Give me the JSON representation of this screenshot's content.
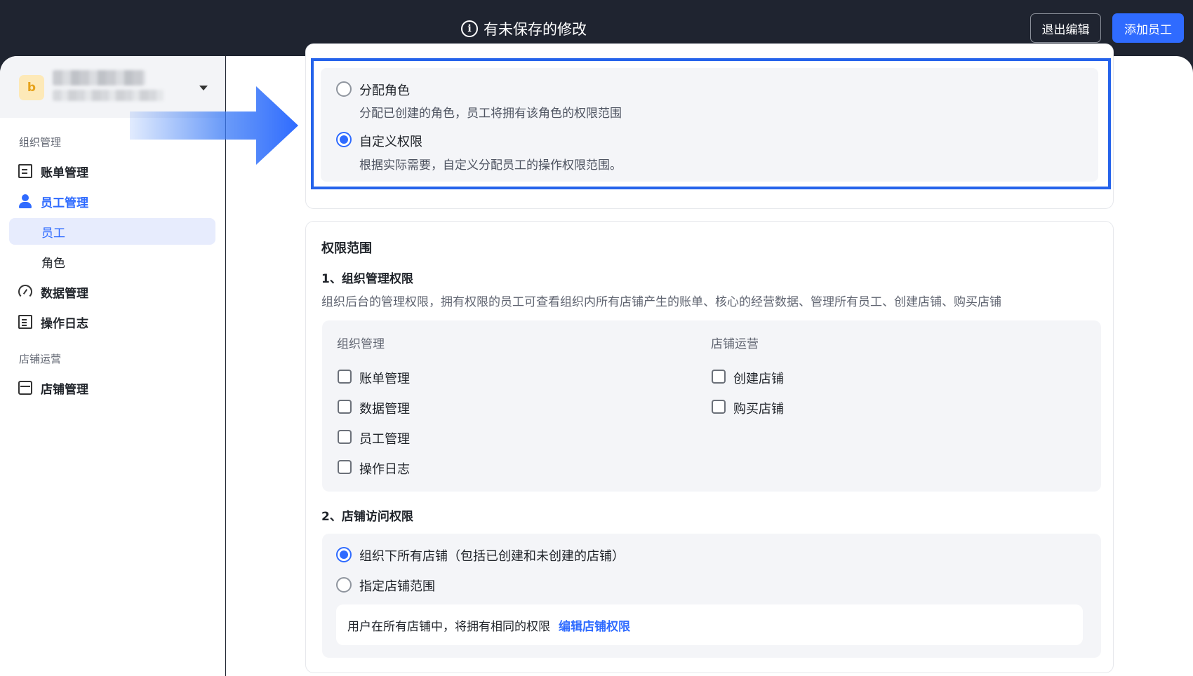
{
  "header": {
    "unsaved_text": "有未保存的修改",
    "exit_button": "退出编辑",
    "add_button": "添加员工"
  },
  "sidebar": {
    "logo_letter": "b",
    "groups": [
      {
        "title": "组织管理"
      },
      {
        "title": "店铺运营"
      }
    ],
    "items": {
      "bill": "账单管理",
      "staff": "员工管理",
      "staff_sub": "员工",
      "role_sub": "角色",
      "data": "数据管理",
      "log": "操作日志",
      "shop": "店铺管理"
    }
  },
  "role_assign": {
    "option1_label": "分配角色",
    "option1_desc": "分配已创建的角色，员工将拥有该角色的权限范围",
    "option2_label": "自定义权限",
    "option2_desc": "根据实际需要，自定义分配员工的操作权限范围。",
    "selected": "自定义权限"
  },
  "permissions": {
    "title": "权限范围",
    "org_title": "1、组织管理权限",
    "org_desc": "组织后台的管理权限，拥有权限的员工可查看组织内所有店铺产生的账单、核心的经营数据、管理所有员工、创建店铺、购买店铺",
    "col1_head": "组织管理",
    "col1_items": [
      "账单管理",
      "数据管理",
      "员工管理",
      "操作日志"
    ],
    "col2_head": "店铺运营",
    "col2_items": [
      "创建店铺",
      "购买店铺"
    ],
    "shop_title": "2、店铺访问权限",
    "shop_option1": "组织下所有店铺（包括已创建和未创建的店铺）",
    "shop_option2": "指定店铺范围",
    "note_text": "用户在所有店铺中，将拥有相同的权限",
    "note_link": "编辑店铺权限"
  },
  "colors": {
    "accent": "#2f6bff",
    "highlight_border": "#2563eb",
    "topbar": "#1f2430"
  }
}
